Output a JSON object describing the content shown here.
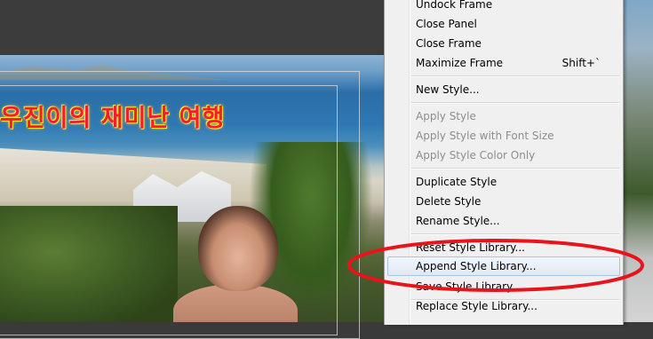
{
  "preview": {
    "title_text": "우진이의 재미난 여행"
  },
  "menu": {
    "items": [
      {
        "label": "Undock Frame",
        "shortcut": "",
        "disabled": false
      },
      {
        "label": "Close Panel",
        "shortcut": "",
        "disabled": false
      },
      {
        "label": "Close Frame",
        "shortcut": "",
        "disabled": false
      },
      {
        "label": "Maximize Frame",
        "shortcut": "Shift+`",
        "disabled": false
      },
      {
        "label": "New Style...",
        "shortcut": "",
        "disabled": false
      },
      {
        "label": "Apply Style",
        "shortcut": "",
        "disabled": true
      },
      {
        "label": "Apply Style with Font Size",
        "shortcut": "",
        "disabled": true
      },
      {
        "label": "Apply Style Color Only",
        "shortcut": "",
        "disabled": true
      },
      {
        "label": "Duplicate Style",
        "shortcut": "",
        "disabled": false
      },
      {
        "label": "Delete Style",
        "shortcut": "",
        "disabled": false
      },
      {
        "label": "Rename Style...",
        "shortcut": "",
        "disabled": false
      },
      {
        "label": "Reset Style Library...",
        "shortcut": "",
        "disabled": false
      },
      {
        "label": "Append Style Library...",
        "shortcut": "",
        "disabled": false,
        "highlighted": true
      },
      {
        "label": "Save Style Library...",
        "shortcut": "",
        "disabled": false
      },
      {
        "label": "Replace Style Library...",
        "shortcut": "",
        "disabled": false
      }
    ]
  },
  "colors": {
    "annotation": "#e8141b",
    "menu_background": "#f0f0f0",
    "disabled_text": "#8d8d8d",
    "highlight_border": "#a8c4e6"
  }
}
